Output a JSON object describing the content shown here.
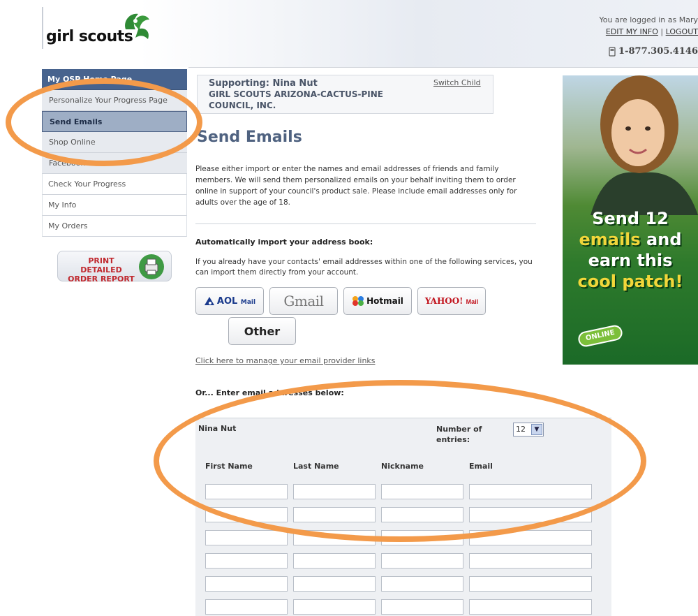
{
  "header": {
    "logo_text": "girl scouts",
    "login_text": "You are logged in as Mary",
    "edit_info": "EDIT MY INFO",
    "separator": "|",
    "logout": "LOGOUT",
    "phone": "1-877.305.4146"
  },
  "nav": {
    "home": "My QSP Home Page",
    "personalize": "Personalize Your Progress Page",
    "send_emails": "Send Emails",
    "shop_online": "Shop Online",
    "facebook": "Facebook",
    "check_progress": "Check Your Progress",
    "my_info": "My Info",
    "my_orders": "My Orders",
    "print_report_line1": "PRINT DETAILED",
    "print_report_line2": "ORDER REPORT"
  },
  "support": {
    "label": "Supporting:",
    "name": "Nina Nut",
    "org": "GIRL SCOUTS ARIZONA-CACTUS-PINE COUNCIL, INC.",
    "switch": "Switch Child"
  },
  "main": {
    "title": "Send Emails",
    "intro": "Please either import or enter the names and email addresses of friends and family members. We will send them personalized emails on your behalf inviting them to order online in support of your council's product sale. Please include email addresses only for adults over the age of 18.",
    "auto_heading": "Automatically import your address book:",
    "auto_desc": "If you already have your contacts' email addresses within one of the following services, you can import them directly from your account.",
    "providers": {
      "aol": "AOL",
      "aol_mail": "Mail",
      "gmail": "Gmail",
      "hotmail": "Hotmail",
      "yahoo": "YAHOO!",
      "yahoo_mail": "Mail",
      "other": "Other"
    },
    "manage_link": "Click here to manage your email provider links",
    "or_enter": "Or... Enter email addresses below:"
  },
  "entries": {
    "child_name": "Nina Nut",
    "num_label": "Number of entries:",
    "num_value": "12",
    "col_first": "First Name",
    "col_last": "Last Name",
    "col_nick": "Nickname",
    "col_email": "Email"
  },
  "ad": {
    "line1": "Send 12",
    "line2_a": "emails",
    "line2_b": "and",
    "line3": "earn this",
    "line4": "cool patch!",
    "badge": "ONLINE"
  },
  "colors": {
    "nav_home": "#47638e",
    "highlight": "#f39a4a",
    "title": "#4f6280"
  }
}
